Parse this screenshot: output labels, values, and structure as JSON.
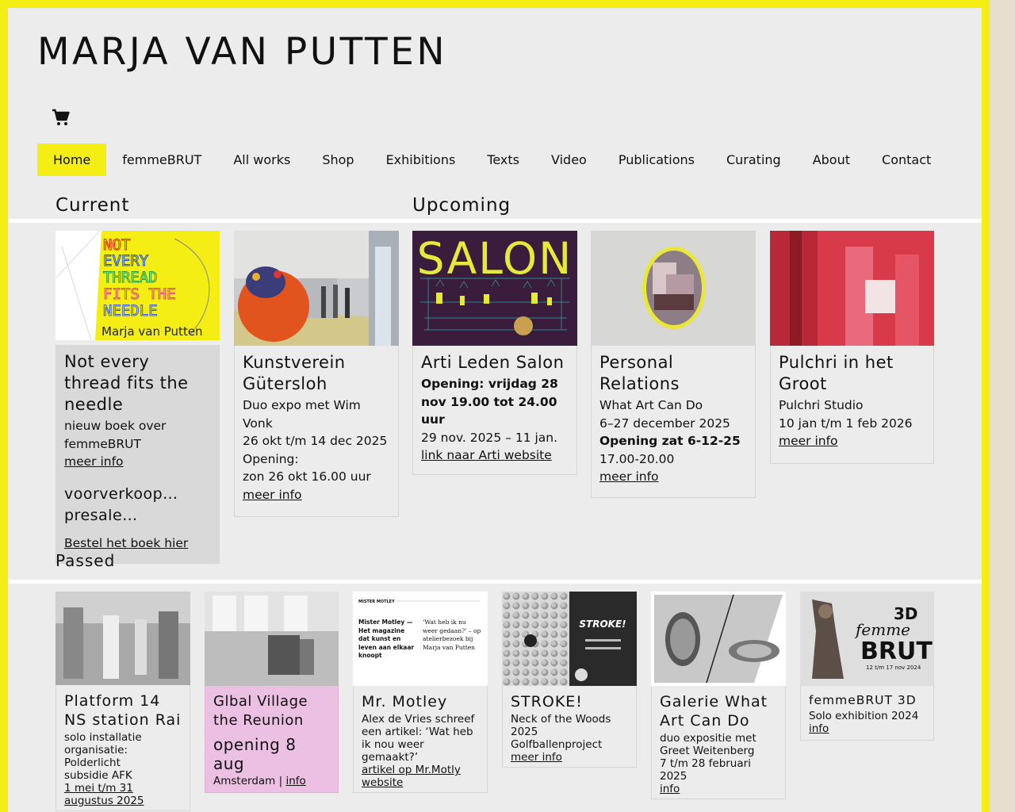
{
  "site": {
    "title": "MARJA VAN PUTTEN",
    "cart_icon": "shopping-cart-icon"
  },
  "colors": {
    "accent": "#f4ee14",
    "page_bg": "#ececec",
    "pink_card": "#ecc0e3",
    "gray_card": "#d9d9d9"
  },
  "nav": {
    "items": [
      {
        "label": "Home"
      },
      {
        "label": "femmeBRUT"
      },
      {
        "label": "All works"
      },
      {
        "label": "Shop"
      },
      {
        "label": "Exhibitions"
      },
      {
        "label": "Texts"
      },
      {
        "label": "Video"
      },
      {
        "label": "Publications"
      },
      {
        "label": "Curating"
      },
      {
        "label": "About"
      },
      {
        "label": "Contact"
      }
    ]
  },
  "sections": {
    "current": "Current",
    "upcoming": "Upcoming",
    "passed": "Passed"
  },
  "current": [
    {
      "title": "Not every thread fits the needle",
      "line1": "nieuw boek over femmeBRUT",
      "link1": "meer info",
      "title2": "voorverkoop… presale…",
      "link2": "Bestel het boek hier",
      "image_text": [
        "NOT",
        "EVERY",
        "THREAD",
        "FITS THE",
        "NEEDLE",
        "Marja van Putten"
      ]
    },
    {
      "title": "Kunstverein Gütersloh",
      "line1": "Duo expo met Wim Vonk",
      "line2": "26 okt t/m 14 dec 2025",
      "line3": "Opening:",
      "line4": "zon 26 okt 16.00 uur",
      "link": "meer info"
    }
  ],
  "upcoming": [
    {
      "title": "Arti Leden Salon",
      "bold": "Opening: vrijdag 28 nov 19.00 tot 24.00 uur",
      "line1": "29 nov. 2025 – 11 jan.",
      "link": "link naar Arti website",
      "image_text": "SALON"
    },
    {
      "title": "Personal Relations",
      "line1": "What Art Can Do",
      "line2": "6–27 december 2025",
      "bold": "Opening zat 6-12-25",
      "line3": "17.00-20.00",
      "link": "meer info"
    },
    {
      "title": "Pulchri in het Groot",
      "line1": "Pulchri Studio",
      "line2": "10 jan t/m 1 feb 2026",
      "link": "meer info"
    }
  ],
  "passed": [
    {
      "title": "Platform 14 NS station Rai",
      "line1": "solo installatie",
      "line2": "organisatie: Polderlicht",
      "line3": "subsidie AFK",
      "link": "1 mei t/m 31 augustus 2025"
    },
    {
      "title": "Glbal Village the Reunion",
      "title2": "opening 8 aug",
      "line1": "Amsterdam | ",
      "link": "info"
    },
    {
      "title": "Mr. Motley",
      "line1": "Alex de Vries schreef een artikel: ‘Wat heb ik nou weer gemaakt?’",
      "link": "artikel op Mr.Motly website",
      "image_text_left": "Mister Motley — Het magazine dat kunst en leven aan elkaar knoopt",
      "image_text_right": "‘Wat heb ik nu weer gedaan?’ – op atelierbezoek bij Marja van Putten",
      "image_logo": "MISTER MOTLEY"
    },
    {
      "title": "STROKE!",
      "line1": "Neck of the Woods 2025",
      "line2": "Golfballenproject",
      "link": "meer info",
      "image_text": "STROKE!"
    },
    {
      "title": "Galerie What Art Can Do",
      "line1": "duo expositie met Greet Weitenberg",
      "line2": "7 t/m 28 februari 2025",
      "link": "info"
    },
    {
      "title": "femmeBRUT 3D",
      "line1": "Solo exhibition 2024",
      "link": "info",
      "image_text": [
        "3D",
        "femme",
        "BRUT",
        "12 t/m 17 nov 2024"
      ]
    }
  ]
}
